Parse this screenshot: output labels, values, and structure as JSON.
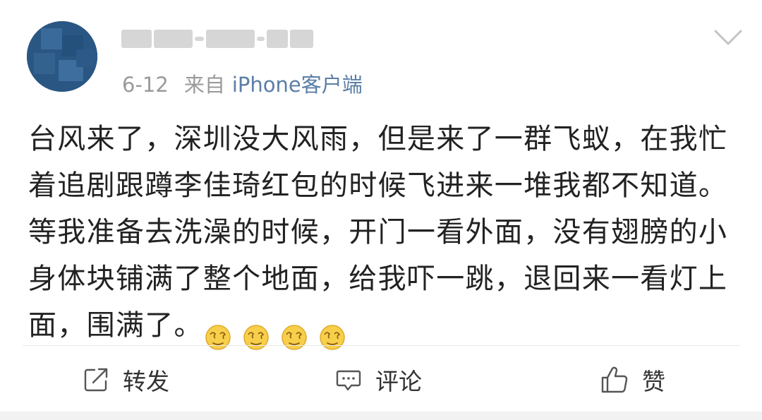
{
  "post": {
    "author": {
      "name_blurred": "██ ████-██ ██",
      "avatar_color": "#2f5d8c"
    },
    "timestamp": "6-12",
    "from_label": "来自",
    "source": "iPhone客户端",
    "content": "台风来了，深圳没大风雨，但是来了一群飞蚁，在我忙着追剧跟蹲李佳琦红包的时候飞进来一堆我都不知道。等我准备去洗澡的时候，开门一看外面，没有翅膀的小身体块铺满了整个地面，给我吓一跳，退回来一看灯上面，围满了。",
    "emojis": [
      "dizzy-face-emoji",
      "dizzy-face-emoji",
      "dizzy-face-emoji",
      "dizzy-face-emoji"
    ]
  },
  "actions": {
    "repost": {
      "icon": "share-icon",
      "label": "转发"
    },
    "comment": {
      "icon": "comment-icon",
      "label": "评论"
    },
    "like": {
      "icon": "thumbs-up-icon",
      "label": "赞"
    }
  },
  "colors": {
    "text": "#222222",
    "meta": "#9a9a9a",
    "source_link": "#5b7ea6",
    "divider": "#e8e8e8"
  }
}
